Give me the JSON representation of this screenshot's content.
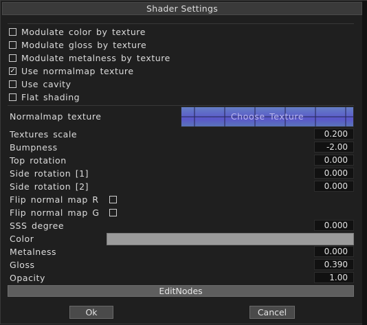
{
  "window": {
    "title": "Shader Settings"
  },
  "checkboxes": [
    {
      "label": "Modulate color by texture",
      "checked": false
    },
    {
      "label": "Modulate gloss by texture",
      "checked": false
    },
    {
      "label": "Modulate metalness by texture",
      "checked": false
    },
    {
      "label": "Use normalmap texture",
      "checked": true
    },
    {
      "label": "Use cavity",
      "checked": false
    },
    {
      "label": "Flat shading",
      "checked": false
    }
  ],
  "normalmap": {
    "label": "Normalmap texture",
    "button_label": "Choose Texture"
  },
  "params": {
    "textures_scale": {
      "label": "Textures scale",
      "value": "0.200"
    },
    "bumpness": {
      "label": "Bumpness",
      "value": "-2.00"
    },
    "top_rotation": {
      "label": "Top rotation",
      "value": "0.000"
    },
    "side_rotation_1": {
      "label": "Side rotation [1]",
      "value": "0.000"
    },
    "side_rotation_2": {
      "label": "Side rotation [2]",
      "value": "0.000"
    },
    "flip_r": {
      "label": "Flip normal map R",
      "checked": false
    },
    "flip_g": {
      "label": "Flip normal map G",
      "checked": false
    },
    "sss_degree": {
      "label": "SSS degree",
      "value": "0.000"
    },
    "color": {
      "label": "Color",
      "swatch": "#9b9b9b"
    },
    "metalness": {
      "label": "Metalness",
      "value": "0.000"
    },
    "gloss": {
      "label": "Gloss",
      "value": "0.390"
    },
    "opacity": {
      "label": "Opacity",
      "value": "1.00"
    }
  },
  "buttons": {
    "edit_nodes": "EditNodes",
    "ok": "Ok",
    "cancel": "Cancel"
  },
  "icons": {
    "checked_glyph": "✓"
  }
}
